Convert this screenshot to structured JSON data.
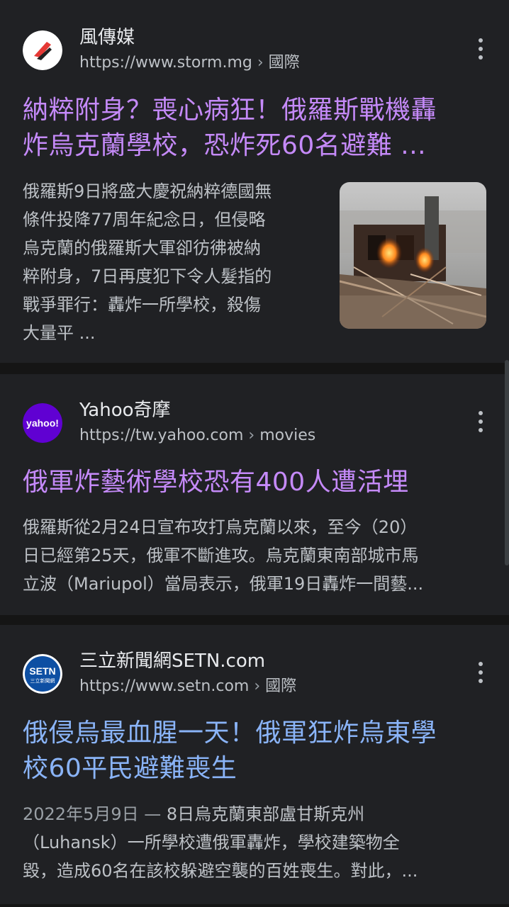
{
  "results": [
    {
      "site_name": "風傳媒",
      "url": "https://www.storm.mg",
      "url_path": "國際",
      "title_lines": [
        "納粹附身？喪心病狂！俄羅斯戰機轟",
        "炸烏克蘭學校，恐炸死60名避難 ..."
      ],
      "snippet_lines": [
        "俄羅斯9日將盛大慶祝納粹德國無",
        "條件投降77周年紀念日，但侵略",
        "烏克蘭的俄羅斯大軍卻彷彿被納",
        "粹附身，7日再度犯下令人髮指的",
        "戰爭罪行：轟炸一所學校，殺傷",
        "大量平 ..."
      ],
      "has_thumbnail": true,
      "favicon": "storm-logo-icon",
      "visited": true
    },
    {
      "site_name": "Yahoo奇摩",
      "url": "https://tw.yahoo.com",
      "url_path": "movies",
      "title_lines": [
        "俄軍炸藝術學校恐有400人遭活埋"
      ],
      "snippet_lines": [
        "俄羅斯從2月24日宣布攻打烏克蘭以來，至今（20）",
        "日已經第25天，俄軍不斷進攻。烏克蘭東南部城市馬",
        "立波（Mariupol）當局表示，俄軍19日轟炸一間藝..."
      ],
      "favicon_text": "yahoo!",
      "favicon": "yahoo-logo-icon",
      "visited": true
    },
    {
      "site_name": "三立新聞網SETN.com",
      "url": "https://www.setn.com",
      "url_path": "國際",
      "title_lines": [
        "俄侵烏最血腥一天！俄軍狂炸烏東學",
        "校60平民避難喪生"
      ],
      "snippet_date": "2022年5月9日 —",
      "snippet_lines": [
        " 8日烏克蘭東部盧甘斯克州",
        "（Luhansk）一所學校遭俄軍轟炸，學校建築物全",
        "毀，造成60名在該校躲避空襲的百姓喪生。對此，..."
      ],
      "favicon_text": "SETN",
      "favicon_subtext": "三立新聞網",
      "favicon": "setn-logo-icon",
      "visited": false
    }
  ],
  "separator": "›",
  "colors": {
    "background": "#202124",
    "visited_link": "#c58af9",
    "link": "#8ab4f8",
    "text": "#bdc1c6"
  }
}
